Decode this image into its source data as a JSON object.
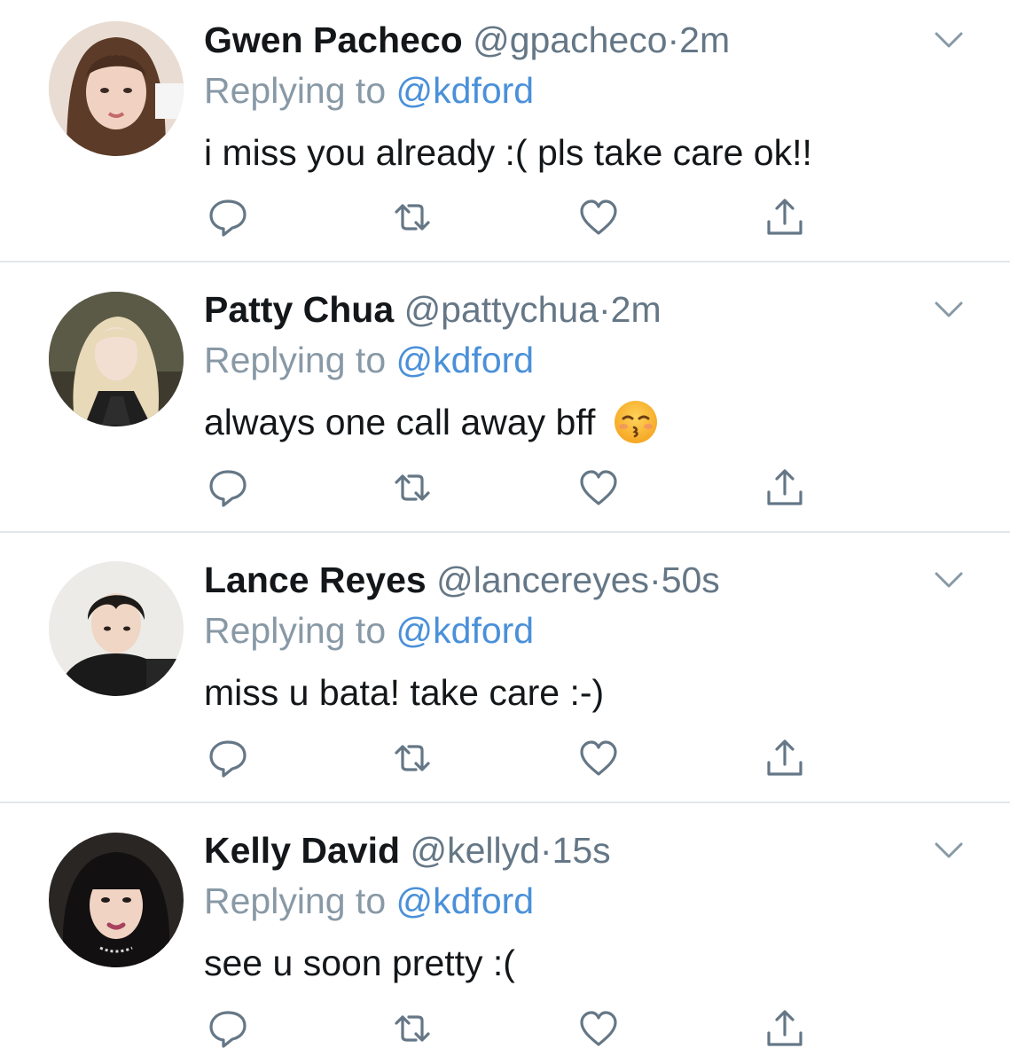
{
  "colors": {
    "text": "#14171a",
    "secondary": "#657786",
    "mention": "#4a90d9",
    "divider": "#e1e8ed",
    "icon": "#657786"
  },
  "replying_label": "Replying to",
  "tweets": [
    {
      "display_name": "Gwen Pacheco",
      "handle": "@gpacheco",
      "separator": "·",
      "time": "2m",
      "reply_to": "@kdford",
      "text": "i miss you already :( pls take care ok!!",
      "emoji": null
    },
    {
      "display_name": "Patty Chua",
      "handle": "@pattychua",
      "separator": "·",
      "time": "2m",
      "reply_to": "@kdford",
      "text": "always one call away bff",
      "emoji": "kissing-face-with-closed-eyes"
    },
    {
      "display_name": "Lance Reyes",
      "handle": "@lancereyes",
      "separator": "·",
      "time": "50s",
      "reply_to": "@kdford",
      "text": "miss u bata! take care :-)",
      "emoji": null
    },
    {
      "display_name": "Kelly David",
      "handle": "@kellyd",
      "separator": "·",
      "time": "15s",
      "reply_to": "@kdford",
      "text": "see u soon pretty :(",
      "emoji": null
    }
  ],
  "icons": {
    "reply": "reply-bubble-icon",
    "retweet": "retweet-icon",
    "like": "heart-icon",
    "share": "share-icon",
    "menu": "chevron-down-icon"
  }
}
